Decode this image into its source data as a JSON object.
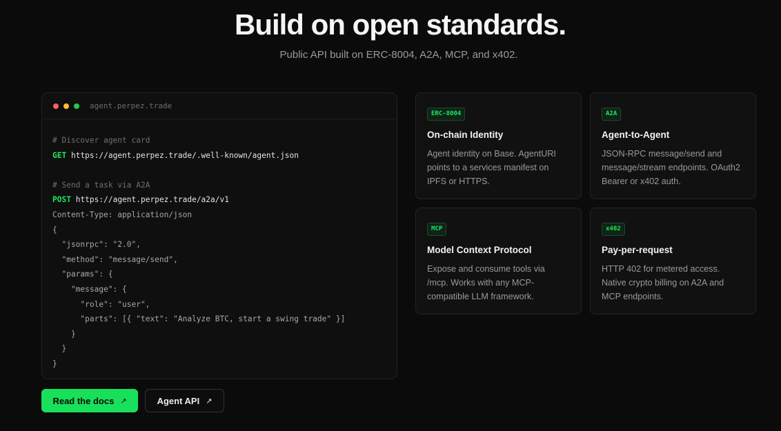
{
  "hero": {
    "title": "Build on open standards.",
    "subtitle": "Public API built on ERC-8004, A2A, MCP, and x402."
  },
  "terminal": {
    "title": "agent.perpez.trade",
    "lines": [
      {
        "comment": "# Discover agent card"
      },
      {
        "method": "GET",
        "url": "https://agent.perpez.trade/.well-known/agent.json"
      },
      {
        "text": ""
      },
      {
        "comment": "# Send a task via A2A"
      },
      {
        "method": "POST",
        "url": "https://agent.perpez.trade/a2a/v1"
      },
      {
        "text": "Content-Type: application/json"
      },
      {
        "text": "{"
      },
      {
        "text": "  \"jsonrpc\": \"2.0\","
      },
      {
        "text": "  \"method\": \"message/send\","
      },
      {
        "text": "  \"params\": {"
      },
      {
        "text": "    \"message\": {"
      },
      {
        "text": "      \"role\": \"user\","
      },
      {
        "text": "      \"parts\": [{ \"text\": \"Analyze BTC, start a swing trade\" }]"
      },
      {
        "text": "    }"
      },
      {
        "text": "  }"
      },
      {
        "text": "}"
      }
    ]
  },
  "buttons": {
    "docs_label": "Read the docs",
    "api_label": "Agent API",
    "arrow": "↗"
  },
  "cards": [
    {
      "badge": "ERC-8004",
      "title": "On-chain Identity",
      "desc": "Agent identity on Base. AgentURI\npoints to a services manifest on\nIPFS or HTTPS."
    },
    {
      "badge": "A2A",
      "title": "Agent-to-Agent",
      "desc": "JSON-RPC message/send and\nmessage/stream endpoints. OAuth2\nBearer or x402 auth."
    },
    {
      "badge": "MCP",
      "title": "Model Context Protocol",
      "desc": "Expose and consume tools via\n/mcp. Works with any MCP-\ncompatible LLM framework."
    },
    {
      "badge": "x402",
      "title": "Pay-per-request",
      "desc": "HTTP 402 for metered access.\nNative crypto billing on A2A and\nMCP endpoints."
    }
  ],
  "colors": {
    "accent": "#1ee85c",
    "background": "#0b0b0b"
  }
}
